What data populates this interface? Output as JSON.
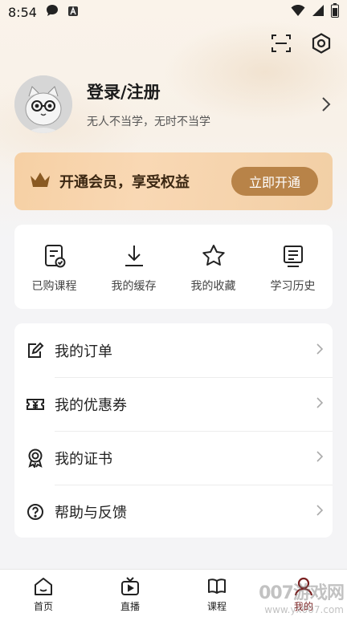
{
  "status_bar": {
    "time": "8:54"
  },
  "profile": {
    "name": "登录/注册",
    "slogan": "无人不当学，无时不当学"
  },
  "vip": {
    "title": "开通会员，享受权益",
    "button_label": "立即开通"
  },
  "quick_actions": [
    {
      "label": "已购课程",
      "icon": "purchased-course-icon"
    },
    {
      "label": "我的缓存",
      "icon": "download-icon"
    },
    {
      "label": "我的收藏",
      "icon": "star-icon"
    },
    {
      "label": "学习历史",
      "icon": "history-icon"
    }
  ],
  "menu": [
    {
      "label": "我的订单",
      "icon": "order-icon"
    },
    {
      "label": "我的优惠券",
      "icon": "coupon-icon"
    },
    {
      "label": "我的证书",
      "icon": "certificate-icon"
    },
    {
      "label": "帮助与反馈",
      "icon": "help-icon"
    }
  ],
  "tabs": [
    {
      "label": "首页",
      "icon": "home-icon"
    },
    {
      "label": "直播",
      "icon": "live-tv-icon"
    },
    {
      "label": "课程",
      "icon": "book-icon"
    },
    {
      "label": "我的",
      "icon": "user-icon",
      "active": true
    }
  ],
  "colors": {
    "accent_gold": "#b88348",
    "vip_bg": "#f6d0a4",
    "active_tab": "#7a2020"
  },
  "watermark": {
    "line1": "007游戏网",
    "line2": "www.yx007.com"
  }
}
